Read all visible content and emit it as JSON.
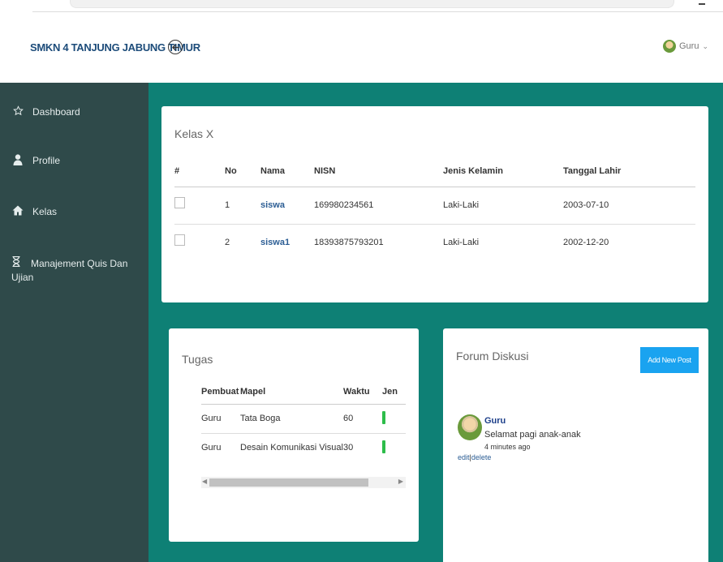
{
  "app": {
    "brand": "SMKN 4 TANJUNG JABUNG TIMUR",
    "user_name": "Guru"
  },
  "sidebar": {
    "items": [
      {
        "icon": "star-icon",
        "label": "Dashboard"
      },
      {
        "icon": "user-icon",
        "label": "Profile"
      },
      {
        "icon": "home-icon",
        "label": "Kelas"
      },
      {
        "icon": "hourglass-icon",
        "label": "Manajement Quis Dan Ujian"
      }
    ]
  },
  "kelas": {
    "title": "Kelas X",
    "headers": [
      "#",
      "No",
      "Nama",
      "NISN",
      "Jenis Kelamin",
      "Tanggal Lahir"
    ],
    "rows": [
      {
        "no": "1",
        "nama": "siswa",
        "nisn": "169980234561",
        "jk": "Laki-Laki",
        "tgl": "2003-07-10"
      },
      {
        "no": "2",
        "nama": "siswa1",
        "nisn": "18393875793201",
        "jk": "Laki-Laki",
        "tgl": "2002-12-20"
      }
    ]
  },
  "tugas": {
    "title": "Tugas",
    "headers": [
      "Pembuat",
      "Mapel",
      "Waktu",
      "Jen"
    ],
    "rows": [
      {
        "pembuat": "Guru",
        "mapel": "Tata Boga",
        "waktu": "60"
      },
      {
        "pembuat": "Guru",
        "mapel": "Desain Komunikasi Visual",
        "waktu": "30"
      }
    ]
  },
  "forum": {
    "title": "Forum Diskusi",
    "add_button": "Add New Post",
    "post": {
      "author": "Guru",
      "message": "Selamat pagi anak-anak",
      "time": "4 minutes ago",
      "edit": "edit",
      "separator": "|",
      "delete": "delete"
    }
  },
  "colors": {
    "sidebar_bg": "#2f4a4a",
    "main_bg": "#0e8075",
    "brand_text": "#1d4c7a",
    "button_blue": "#1aa3f0",
    "status_green": "#2dbd4a"
  }
}
